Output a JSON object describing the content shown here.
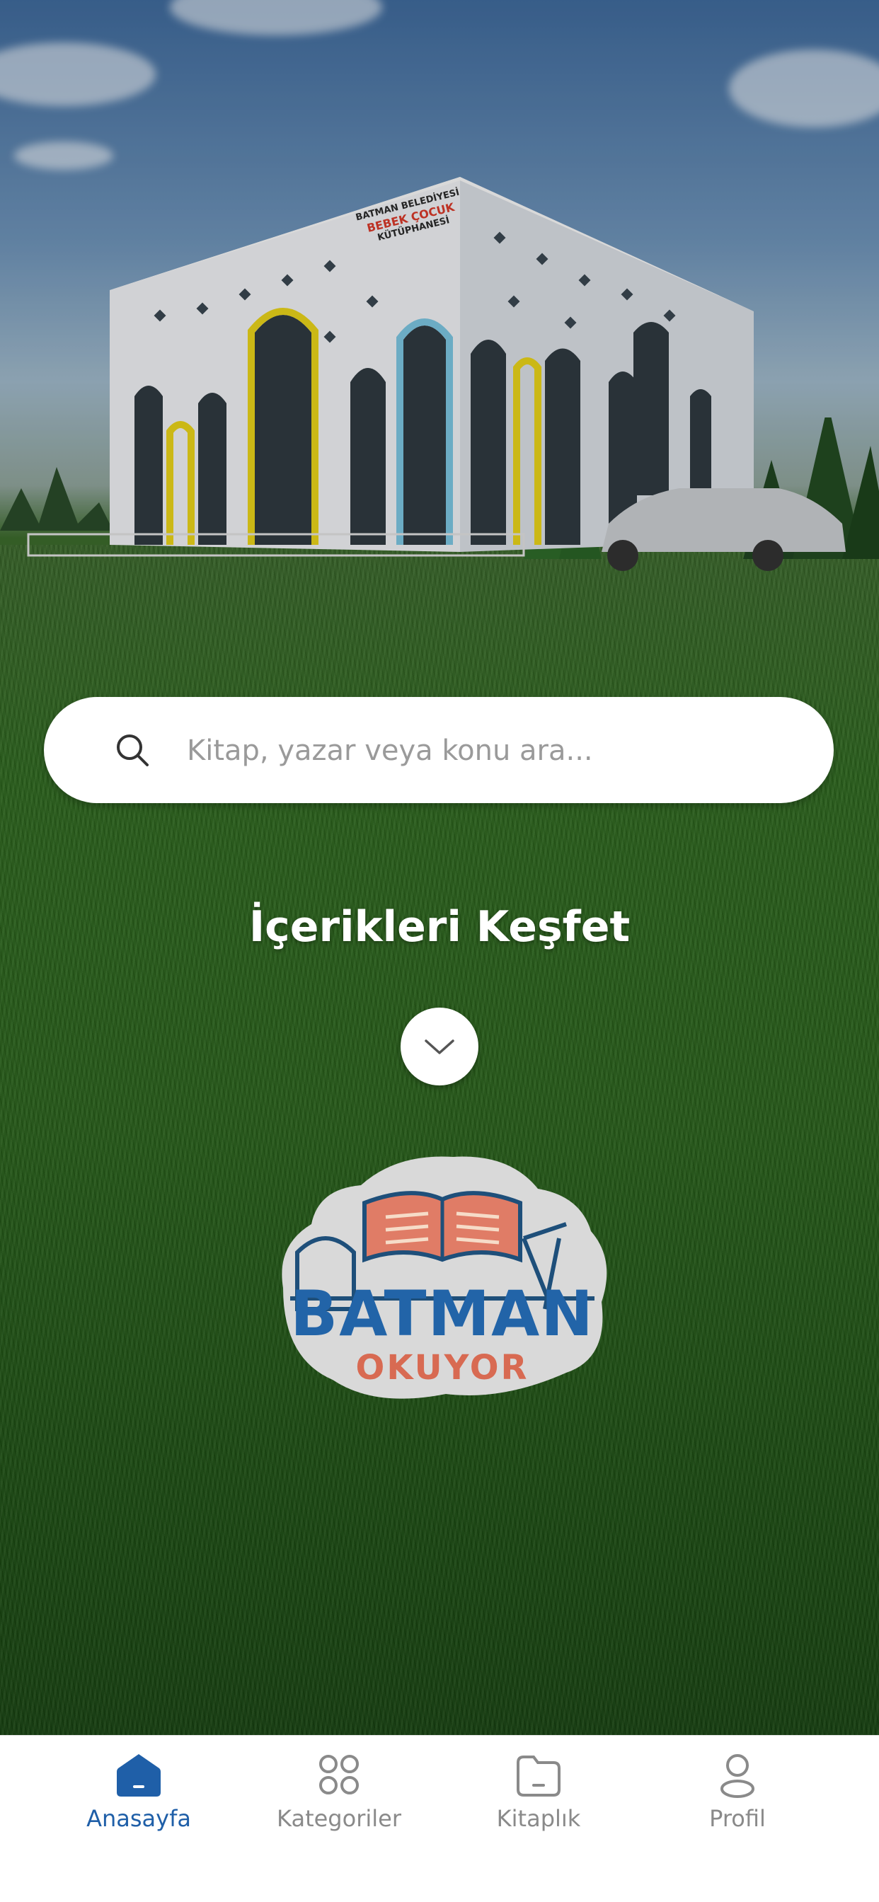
{
  "search": {
    "placeholder": "Kitap, yazar veya konu ara..."
  },
  "discover": {
    "title": "İçerikleri Keşfet"
  },
  "building_sign": {
    "line1": "BATMAN BELEDİYESİ",
    "line2": "BEBEK ÇOCUK",
    "line3": "KÜTÜPHANESİ"
  },
  "logo": {
    "line1": "BATMAN",
    "line2": "OKUYOR"
  },
  "nav": {
    "items": [
      {
        "label": "Anasayfa",
        "icon": "home-icon",
        "active": true
      },
      {
        "label": "Kategoriler",
        "icon": "grid-icon",
        "active": false
      },
      {
        "label": "Kitaplık",
        "icon": "folder-icon",
        "active": false
      },
      {
        "label": "Profil",
        "icon": "profile-icon",
        "active": false
      }
    ]
  },
  "colors": {
    "accent": "#1f5fa8",
    "inactive": "#8a8a8a",
    "grass": "#2f6a1f"
  }
}
